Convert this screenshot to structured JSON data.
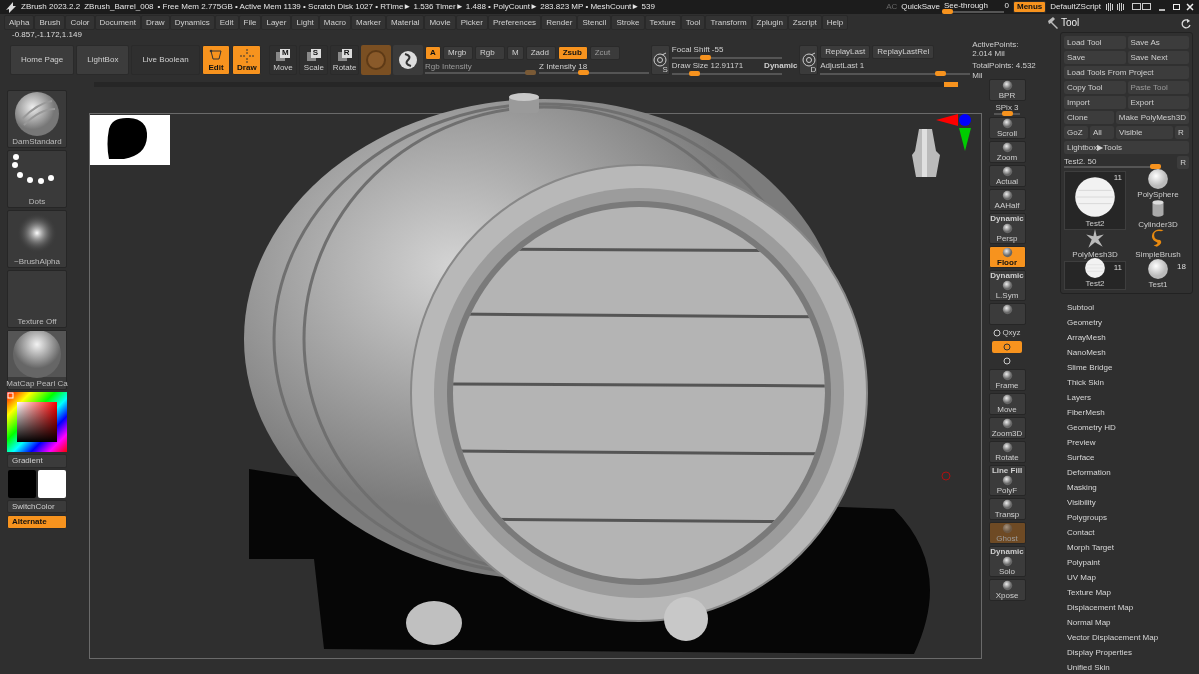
{
  "title_bar": {
    "app": "ZBrush 2023.2.2",
    "document": "ZBrush_Barrel_008",
    "stats": "• Free Mem 2.775GB • Active Mem 1139 • Scratch Disk 1027 •  RTime► 1.536 Timer► 1.488 • PolyCount► 283.823 MP • MeshCount► 539",
    "ac": "AC",
    "quicksave": "QuickSave",
    "see_through": {
      "label": "See-through",
      "value": "0",
      "level": 0.05
    },
    "menus": {
      "label": "Menus",
      "on": true
    },
    "script": "DefaultZScript"
  },
  "menu_bar": [
    "Alpha",
    "Brush",
    "Color",
    "Document",
    "Draw",
    "Dynamics",
    "Edit",
    "File",
    "Layer",
    "Light",
    "Macro",
    "Marker",
    "Material",
    "Movie",
    "Picker",
    "Preferences",
    "Render",
    "Stencil",
    "Stroke",
    "Texture",
    "Tool",
    "Transform",
    "Zplugin",
    "Zscript",
    "Help"
  ],
  "coordinates": "-0.857,-1.172,1.149",
  "toolbar": {
    "nav_buttons": [
      "Home Page",
      "LightBox",
      "Live Boolean"
    ],
    "transform_buttons": [
      {
        "kind": "edit",
        "label": "Edit",
        "selected": true
      },
      {
        "kind": "draw",
        "label": "Draw",
        "selected": true
      },
      {
        "kind": "move",
        "label": "Move",
        "key": "M",
        "selected": false
      },
      {
        "kind": "scale",
        "label": "Scale",
        "key": "S",
        "selected": false
      },
      {
        "kind": "rotate",
        "label": "Rotate",
        "key": "R",
        "selected": false
      }
    ],
    "modes": [
      {
        "label": "A",
        "on": true,
        "disabled": false
      },
      {
        "label": "Mrgb",
        "on": false,
        "disabled": false
      },
      {
        "label": "Rgb",
        "on": false,
        "disabled": false
      },
      {
        "label": "M",
        "on": false,
        "disabled": false
      },
      {
        "label": "Zadd",
        "on": false,
        "disabled": false
      },
      {
        "label": "Zsub",
        "on": true,
        "disabled": false
      },
      {
        "label": "Zcut",
        "on": false,
        "disabled": true
      }
    ],
    "sliders": [
      {
        "label": "Rgb Intensity",
        "disabled": true,
        "level": 0.95
      },
      {
        "label": "Z Intensity 18",
        "disabled": false,
        "level": 0.4
      }
    ],
    "stroke": {
      "key": "S",
      "sliders": [
        {
          "label": "Focal Shift -55",
          "level": 0.3
        },
        {
          "label": "Draw Size 12.91171",
          "level": 0.2
        }
      ],
      "dynamic": "Dynamic"
    },
    "replay": {
      "key": "D",
      "buttons": [
        "ReplayLast",
        "ReplayLastRel"
      ],
      "slider": {
        "label": "AdjustLast 1",
        "level": 0.8
      }
    },
    "points": [
      "ActivePoints: 2.014 Mil",
      "TotalPoints: 4.532 Mil"
    ]
  },
  "left_shelf": {
    "thumbnails": [
      {
        "kind": "brush",
        "label": "DamStandard"
      },
      {
        "kind": "stroke",
        "label": "Dots"
      },
      {
        "kind": "alpha",
        "label": "~BrushAlpha"
      },
      {
        "kind": "texture",
        "label": "Texture Off"
      },
      {
        "kind": "material",
        "label": "MatCap Pearl Ca"
      }
    ],
    "gradient": "Gradient",
    "swatches": [
      {
        "color": "#000000"
      },
      {
        "color": "#ffffff"
      }
    ],
    "switch_color": "SwitchColor",
    "alternate": {
      "label": "Alternate",
      "on": true
    }
  },
  "right_shelf": [
    {
      "kind": "button",
      "label": "BPR",
      "on": false,
      "disabled": false
    },
    {
      "kind": "slider",
      "label": "SPix 3",
      "level": 0.5
    },
    {
      "kind": "button",
      "label": "Scroll",
      "on": false,
      "disabled": false
    },
    {
      "kind": "button",
      "label": "Zoom",
      "on": false,
      "disabled": false
    },
    {
      "kind": "button",
      "label": "Actual",
      "on": false,
      "disabled": false
    },
    {
      "kind": "button",
      "label": "AAHalf",
      "on": false,
      "disabled": false
    },
    {
      "kind": "button",
      "top": "Dynamic",
      "label": "Persp",
      "on": false,
      "disabled": false
    },
    {
      "kind": "button",
      "label": "Floor",
      "on": true,
      "disabled": false
    },
    {
      "kind": "button",
      "top": "Dynamic",
      "label": "L.Sym",
      "on": false,
      "disabled": false
    },
    {
      "kind": "button",
      "on": false,
      "disabled": false
    },
    {
      "kind": "small",
      "label": "Qxyz",
      "on": false,
      "disabled": false
    },
    {
      "kind": "small",
      "on": true,
      "disabled": false
    },
    {
      "kind": "small",
      "on": false,
      "disabled": false
    },
    {
      "kind": "button",
      "label": "Frame",
      "on": false,
      "disabled": false
    },
    {
      "kind": "button",
      "label": "Move",
      "on": false,
      "disabled": false
    },
    {
      "kind": "button",
      "label": "Zoom3D",
      "on": false,
      "disabled": false
    },
    {
      "kind": "button",
      "label": "Rotate",
      "on": false,
      "disabled": false
    },
    {
      "kind": "button",
      "top": "Line Fill",
      "label": "PolyF",
      "on": false,
      "disabled": false
    },
    {
      "kind": "button",
      "label": "Transp",
      "on": false,
      "disabled": false
    },
    {
      "kind": "button",
      "label": "Ghost",
      "on": true,
      "disabled": true
    },
    {
      "kind": "button",
      "top": "Dynamic",
      "label": "Solo",
      "on": false,
      "disabled": false
    },
    {
      "kind": "button",
      "label": "Xpose",
      "on": false,
      "disabled": false
    }
  ],
  "tool_panel": {
    "title": "Tool",
    "button_rows": [
      [
        {
          "label": "Load Tool",
          "disabled": false
        },
        {
          "label": "Save As",
          "disabled": false
        }
      ],
      [
        {
          "label": "Save",
          "disabled": false
        },
        {
          "label": "Save Next",
          "disabled": false
        }
      ],
      [
        {
          "label": "Load Tools From Project",
          "disabled": false
        }
      ],
      [
        {
          "label": "Copy Tool",
          "disabled": false
        },
        {
          "label": "Paste Tool",
          "disabled": true
        }
      ],
      [
        {
          "label": "Import",
          "disabled": false
        },
        {
          "label": "Export",
          "disabled": false
        }
      ],
      [
        {
          "label": "Clone",
          "disabled": false
        },
        {
          "label": "Make PolyMesh3D",
          "disabled": false
        }
      ],
      [
        {
          "label": "GoZ",
          "disabled": false
        },
        {
          "label": "All",
          "disabled": false
        },
        {
          "label": "Visible",
          "disabled": false
        },
        {
          "label": "R",
          "disabled": false
        }
      ],
      [
        {
          "label": "Lightbox▶Tools",
          "disabled": false
        }
      ]
    ],
    "subtool_slider": {
      "label": "Test2. 50",
      "level": 0.95,
      "reset": "R"
    },
    "tools": [
      {
        "kind": "textured-sphere",
        "label": "Test2",
        "count": "11",
        "selected": true
      },
      {
        "kind": "sphere",
        "label": "PolySphere",
        "selected": false
      },
      {
        "kind": "cylinder",
        "label": "Cylinder3D",
        "selected": false
      },
      {
        "kind": "star",
        "label": "PolyMesh3D",
        "selected": false
      },
      {
        "kind": "brush",
        "label": "SimpleBrush",
        "selected": false
      },
      {
        "kind": "textured-sphere",
        "label": "Test2",
        "count": "11",
        "selected": true
      },
      {
        "kind": "sphere",
        "label": "Test1",
        "count": "18",
        "selected": false
      }
    ],
    "subpalettes": [
      "Subtool",
      "Geometry",
      "ArrayMesh",
      "NanoMesh",
      "Slime Bridge",
      "Thick Skin",
      "Layers",
      "FiberMesh",
      "Geometry HD",
      "Preview",
      "Surface",
      "Deformation",
      "Masking",
      "Visibility",
      "Polygroups",
      "Contact",
      "Morph Target",
      "Polypaint",
      "UV Map",
      "Texture Map",
      "Displacement Map",
      "Normal Map",
      "Vector Displacement Map",
      "Display Properties",
      "Unified Skin"
    ]
  }
}
